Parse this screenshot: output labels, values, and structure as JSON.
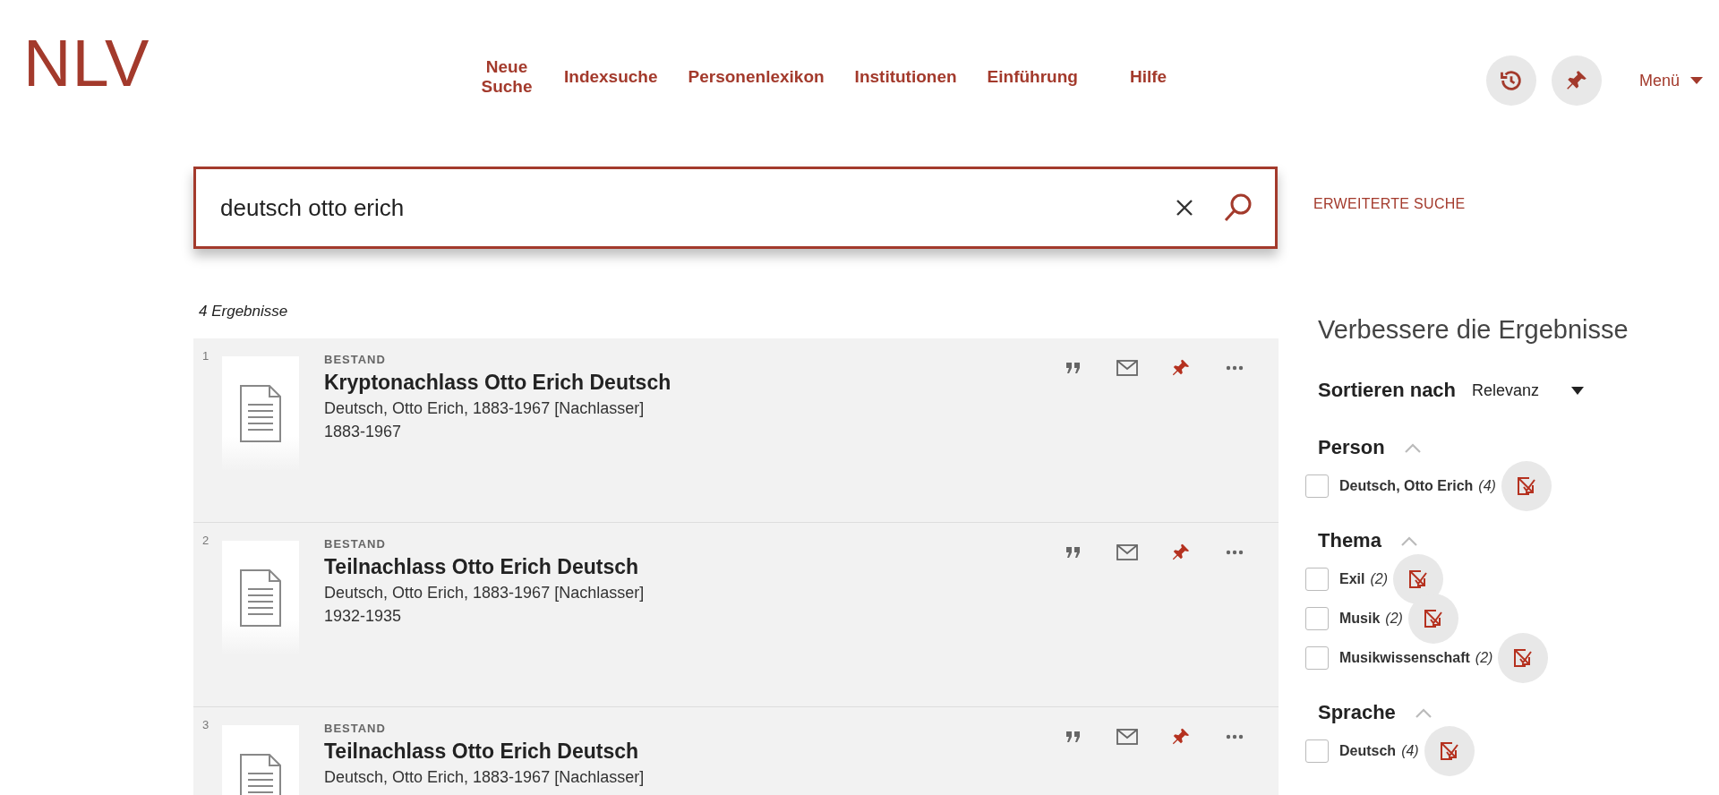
{
  "logo": "NLV",
  "nav": [
    {
      "label": "Neue Suche"
    },
    {
      "label": "Indexsuche"
    },
    {
      "label": "Personenlexikon"
    },
    {
      "label": "Institutionen"
    },
    {
      "label": "Einführung"
    },
    {
      "label": "Hilfe"
    }
  ],
  "menu": "Menü",
  "search": {
    "value": "deutsch otto erich"
  },
  "advanced_search": "ERWEITERTE SUCHE",
  "result_count": "4 Ergebnisse",
  "results": [
    {
      "number": "1",
      "type": "BESTAND",
      "title": "Kryptonachlass Otto Erich Deutsch",
      "author": "Deutsch, Otto Erich, 1883-1967 [Nachlasser]",
      "date": "1883-1967"
    },
    {
      "number": "2",
      "type": "BESTAND",
      "title": "Teilnachlass Otto Erich Deutsch",
      "author": "Deutsch, Otto Erich, 1883-1967 [Nachlasser]",
      "date": "1932-1935"
    },
    {
      "number": "3",
      "type": "BESTAND",
      "title": "Teilnachlass Otto Erich Deutsch",
      "author": "Deutsch, Otto Erich, 1883-1967 [Nachlasser]"
    }
  ],
  "facets": {
    "title": "Verbessere die Ergebnisse",
    "sort_label": "Sortieren nach",
    "sort_value": "Relevanz",
    "groups": [
      {
        "title": "Person",
        "expanded": true,
        "items": [
          {
            "label": "Deutsch, Otto Erich",
            "count": "(4)",
            "checked": false
          }
        ]
      },
      {
        "title": "Thema",
        "expanded": true,
        "items": [
          {
            "label": "Exil",
            "count": "(2)",
            "checked": false
          },
          {
            "label": "Musik",
            "count": "(2)",
            "checked": false
          },
          {
            "label": "Musikwissenschaft",
            "count": "(2)",
            "checked": false
          }
        ]
      },
      {
        "title": "Sprache",
        "expanded": true,
        "items": [
          {
            "label": "Deutsch",
            "count": "(4)",
            "checked": false
          }
        ]
      }
    ]
  }
}
